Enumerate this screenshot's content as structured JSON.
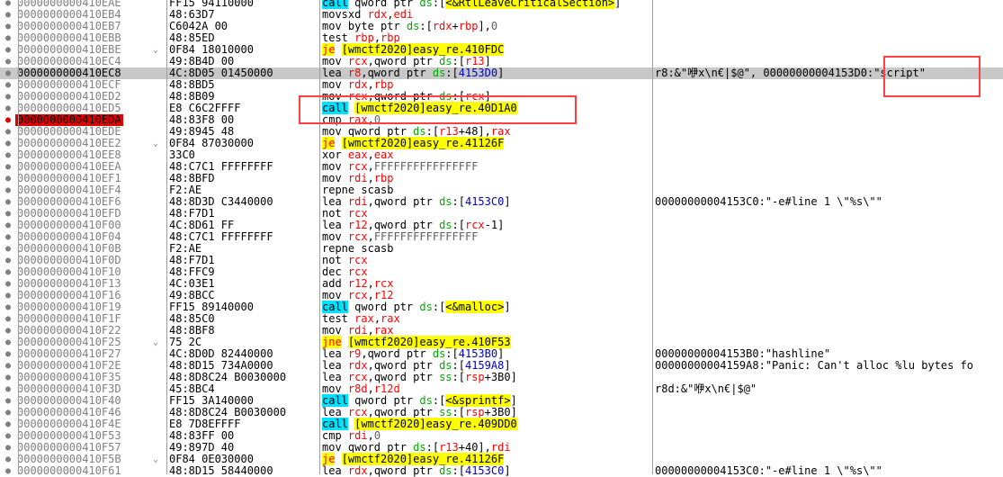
{
  "colors": {
    "call_bg": "#00e0ff",
    "jump_bg": "#ffff00",
    "jump_text": "#ff0000",
    "register": "#ff0000",
    "breakpoint": "#e00000",
    "selected_row": "#c8c8c8",
    "highlight_box": "#ff4040"
  },
  "icons": {
    "breakpoint_dot": "dot-icon",
    "jump_arrow": "chevron-down-icon"
  },
  "rows": [
    {
      "addr": "0000000000410EAE",
      "bytes": "FF15 94110000",
      "dis": [
        {
          "t": "call",
          "c": "mn-call"
        },
        {
          "t": " qword ptr "
        },
        {
          "t": "ds",
          "c": "seg"
        },
        {
          "t": ":["
        },
        {
          "t": "<&RtlLeaveCriticalSection>",
          "c": "tgt"
        },
        {
          "t": "]"
        }
      ],
      "cmt": ""
    },
    {
      "addr": "0000000000410EB4",
      "bytes": "48:63D7",
      "dis": [
        {
          "t": "movsxd "
        },
        {
          "t": "rdx",
          "c": "reg"
        },
        {
          "t": ","
        },
        {
          "t": "edi",
          "c": "reg"
        }
      ],
      "cmt": ""
    },
    {
      "addr": "0000000000410EB7",
      "bytes": "C6042A 00",
      "dis": [
        {
          "t": "mov byte ptr "
        },
        {
          "t": "ds",
          "c": "seg"
        },
        {
          "t": ":["
        },
        {
          "t": "rdx",
          "c": "reg"
        },
        {
          "t": "+"
        },
        {
          "t": "rbp",
          "c": "reg"
        },
        {
          "t": "],"
        },
        {
          "t": "0",
          "c": "imm"
        }
      ],
      "cmt": ""
    },
    {
      "addr": "0000000000410EBB",
      "bytes": "48:85ED",
      "dis": [
        {
          "t": "test "
        },
        {
          "t": "rbp",
          "c": "reg"
        },
        {
          "t": ","
        },
        {
          "t": "rbp",
          "c": "reg"
        }
      ],
      "cmt": ""
    },
    {
      "addr": "0000000000410EBE",
      "bytes": "0F84 18010000",
      "jmp": true,
      "dis": [
        {
          "t": "je",
          "c": "mn-jcc"
        },
        {
          "t": " "
        },
        {
          "t": "[wmctf2020]easy_re.410FDC",
          "c": "tgt"
        }
      ],
      "cmt": ""
    },
    {
      "addr": "0000000000410EC4",
      "bytes": "49:8B4D 00",
      "dis": [
        {
          "t": "mov "
        },
        {
          "t": "rcx",
          "c": "reg"
        },
        {
          "t": ",qword ptr "
        },
        {
          "t": "ds",
          "c": "seg"
        },
        {
          "t": ":["
        },
        {
          "t": "r13",
          "c": "reg"
        },
        {
          "t": "]"
        }
      ],
      "cmt": ""
    },
    {
      "addr": "0000000000410EC8",
      "bytes": "4C:8D05 01450000",
      "sel": true,
      "dis": [
        {
          "t": "lea "
        },
        {
          "t": "r8",
          "c": "reg"
        },
        {
          "t": ",qword ptr "
        },
        {
          "t": "ds",
          "c": "seg"
        },
        {
          "t": ":["
        },
        {
          "t": "4153D0",
          "c": "num"
        },
        {
          "t": "]"
        }
      ],
      "cmt": "r8:&\"咿x\\n€|$@\", 00000000004153D0:\"script\""
    },
    {
      "addr": "0000000000410ECF",
      "bytes": "48:8BD5",
      "dis": [
        {
          "t": "mov "
        },
        {
          "t": "rdx",
          "c": "reg"
        },
        {
          "t": ","
        },
        {
          "t": "rbp",
          "c": "reg"
        }
      ],
      "cmt": ""
    },
    {
      "addr": "0000000000410ED2",
      "bytes": "48:8B09",
      "dis": [
        {
          "t": "mov "
        },
        {
          "t": "rcx",
          "c": "reg"
        },
        {
          "t": ",qword ptr "
        },
        {
          "t": "ds",
          "c": "seg"
        },
        {
          "t": ":["
        },
        {
          "t": "rcx",
          "c": "reg"
        },
        {
          "t": "]"
        }
      ],
      "cmt": ""
    },
    {
      "addr": "0000000000410ED5",
      "bytes": "E8 C6C2FFFF",
      "dis": [
        {
          "t": "call",
          "c": "mn-call"
        },
        {
          "t": " "
        },
        {
          "t": "[wmctf2020]easy_re.40D1A0",
          "c": "tgt"
        }
      ],
      "cmt": ""
    },
    {
      "addr": "0000000000410EDA",
      "bytes": "48:83F8 00",
      "bp": true,
      "dis": [
        {
          "t": "cmp "
        },
        {
          "t": "rax",
          "c": "reg"
        },
        {
          "t": ","
        },
        {
          "t": "0",
          "c": "imm"
        }
      ],
      "cmt": ""
    },
    {
      "addr": "0000000000410EDE",
      "bytes": "49:8945 48",
      "dis": [
        {
          "t": "mov qword ptr "
        },
        {
          "t": "ds",
          "c": "seg"
        },
        {
          "t": ":["
        },
        {
          "t": "r13",
          "c": "reg"
        },
        {
          "t": "+48],"
        },
        {
          "t": "rax",
          "c": "reg"
        }
      ],
      "cmt": ""
    },
    {
      "addr": "0000000000410EE2",
      "bytes": "0F84 87030000",
      "jmp": true,
      "dis": [
        {
          "t": "je",
          "c": "mn-jcc"
        },
        {
          "t": " "
        },
        {
          "t": "[wmctf2020]easy_re.41126F",
          "c": "tgt"
        }
      ],
      "cmt": ""
    },
    {
      "addr": "0000000000410EE8",
      "bytes": "33C0",
      "dis": [
        {
          "t": "xor "
        },
        {
          "t": "eax",
          "c": "reg"
        },
        {
          "t": ","
        },
        {
          "t": "eax",
          "c": "reg"
        }
      ],
      "cmt": ""
    },
    {
      "addr": "0000000000410EEA",
      "bytes": "48:C7C1 FFFFFFFF",
      "dis": [
        {
          "t": "mov "
        },
        {
          "t": "rcx",
          "c": "reg"
        },
        {
          "t": ","
        },
        {
          "t": "FFFFFFFFFFFFFFFF",
          "c": "imm"
        }
      ],
      "cmt": ""
    },
    {
      "addr": "0000000000410EF1",
      "bytes": "48:8BFD",
      "dis": [
        {
          "t": "mov "
        },
        {
          "t": "rdi",
          "c": "reg"
        },
        {
          "t": ","
        },
        {
          "t": "rbp",
          "c": "reg"
        }
      ],
      "cmt": ""
    },
    {
      "addr": "0000000000410EF4",
      "bytes": "F2:AE",
      "dis": [
        {
          "t": "repne scasb"
        }
      ],
      "cmt": ""
    },
    {
      "addr": "0000000000410EF6",
      "bytes": "48:8D3D C3440000",
      "dis": [
        {
          "t": "lea "
        },
        {
          "t": "rdi",
          "c": "reg"
        },
        {
          "t": ",qword ptr "
        },
        {
          "t": "ds",
          "c": "seg"
        },
        {
          "t": ":["
        },
        {
          "t": "4153C0",
          "c": "num"
        },
        {
          "t": "]"
        }
      ],
      "cmt": "00000000004153C0:\"-e#line 1 \\\"%s\\\"\""
    },
    {
      "addr": "0000000000410EFD",
      "bytes": "48:F7D1",
      "dis": [
        {
          "t": "not "
        },
        {
          "t": "rcx",
          "c": "reg"
        }
      ],
      "cmt": ""
    },
    {
      "addr": "0000000000410F00",
      "bytes": "4C:8D61 FF",
      "dis": [
        {
          "t": "lea "
        },
        {
          "t": "r12",
          "c": "reg"
        },
        {
          "t": ",qword ptr "
        },
        {
          "t": "ds",
          "c": "seg"
        },
        {
          "t": ":["
        },
        {
          "t": "rcx",
          "c": "reg"
        },
        {
          "t": "-1]"
        }
      ],
      "cmt": ""
    },
    {
      "addr": "0000000000410F04",
      "bytes": "48:C7C1 FFFFFFFF",
      "dis": [
        {
          "t": "mov "
        },
        {
          "t": "rcx",
          "c": "reg"
        },
        {
          "t": ","
        },
        {
          "t": "FFFFFFFFFFFFFFFF",
          "c": "imm"
        }
      ],
      "cmt": ""
    },
    {
      "addr": "0000000000410F0B",
      "bytes": "F2:AE",
      "dis": [
        {
          "t": "repne scasb"
        }
      ],
      "cmt": ""
    },
    {
      "addr": "0000000000410F0D",
      "bytes": "48:F7D1",
      "dis": [
        {
          "t": "not "
        },
        {
          "t": "rcx",
          "c": "reg"
        }
      ],
      "cmt": ""
    },
    {
      "addr": "0000000000410F10",
      "bytes": "48:FFC9",
      "dis": [
        {
          "t": "dec "
        },
        {
          "t": "rcx",
          "c": "reg"
        }
      ],
      "cmt": ""
    },
    {
      "addr": "0000000000410F13",
      "bytes": "4C:03E1",
      "dis": [
        {
          "t": "add "
        },
        {
          "t": "r12",
          "c": "reg"
        },
        {
          "t": ","
        },
        {
          "t": "rcx",
          "c": "reg"
        }
      ],
      "cmt": ""
    },
    {
      "addr": "0000000000410F16",
      "bytes": "49:8BCC",
      "dis": [
        {
          "t": "mov "
        },
        {
          "t": "rcx",
          "c": "reg"
        },
        {
          "t": ","
        },
        {
          "t": "r12",
          "c": "reg"
        }
      ],
      "cmt": ""
    },
    {
      "addr": "0000000000410F19",
      "bytes": "FF15 89140000",
      "dis": [
        {
          "t": "call",
          "c": "mn-call"
        },
        {
          "t": " qword ptr "
        },
        {
          "t": "ds",
          "c": "seg"
        },
        {
          "t": ":["
        },
        {
          "t": "<&malloc>",
          "c": "tgt"
        },
        {
          "t": "]"
        }
      ],
      "cmt": ""
    },
    {
      "addr": "0000000000410F1F",
      "bytes": "48:85C0",
      "dis": [
        {
          "t": "test "
        },
        {
          "t": "rax",
          "c": "reg"
        },
        {
          "t": ","
        },
        {
          "t": "rax",
          "c": "reg"
        }
      ],
      "cmt": ""
    },
    {
      "addr": "0000000000410F22",
      "bytes": "48:8BF8",
      "dis": [
        {
          "t": "mov "
        },
        {
          "t": "rdi",
          "c": "reg"
        },
        {
          "t": ","
        },
        {
          "t": "rax",
          "c": "reg"
        }
      ],
      "cmt": ""
    },
    {
      "addr": "0000000000410F25",
      "bytes": "75 2C",
      "jmp": true,
      "dis": [
        {
          "t": "jne",
          "c": "mn-jcc"
        },
        {
          "t": " "
        },
        {
          "t": "[wmctf2020]easy_re.410F53",
          "c": "tgt"
        }
      ],
      "cmt": ""
    },
    {
      "addr": "0000000000410F27",
      "bytes": "4C:8D0D 82440000",
      "dis": [
        {
          "t": "lea "
        },
        {
          "t": "r9",
          "c": "reg"
        },
        {
          "t": ",qword ptr "
        },
        {
          "t": "ds",
          "c": "seg"
        },
        {
          "t": ":["
        },
        {
          "t": "4153B0",
          "c": "num"
        },
        {
          "t": "]"
        }
      ],
      "cmt": "00000000004153B0:\"hashline\""
    },
    {
      "addr": "0000000000410F2E",
      "bytes": "48:8D15 734A0000",
      "dis": [
        {
          "t": "lea "
        },
        {
          "t": "rdx",
          "c": "reg"
        },
        {
          "t": ",qword ptr "
        },
        {
          "t": "ds",
          "c": "seg"
        },
        {
          "t": ":["
        },
        {
          "t": "4159A8",
          "c": "num"
        },
        {
          "t": "]"
        }
      ],
      "cmt": "00000000004159A8:\"Panic: Can't alloc %lu bytes fo"
    },
    {
      "addr": "0000000000410F35",
      "bytes": "48:8D8C24 B0030000",
      "dis": [
        {
          "t": "lea "
        },
        {
          "t": "rcx",
          "c": "reg"
        },
        {
          "t": ",qword ptr "
        },
        {
          "t": "ss",
          "c": "seg"
        },
        {
          "t": ":["
        },
        {
          "t": "rsp",
          "c": "reg"
        },
        {
          "t": "+3B0]"
        }
      ],
      "cmt": ""
    },
    {
      "addr": "0000000000410F3D",
      "bytes": "45:8BC4",
      "dis": [
        {
          "t": "mov "
        },
        {
          "t": "r8d",
          "c": "reg"
        },
        {
          "t": ","
        },
        {
          "t": "r12d",
          "c": "reg"
        }
      ],
      "cmt": "r8d:&\"咿x\\n€|$@\""
    },
    {
      "addr": "0000000000410F40",
      "bytes": "FF15 3A140000",
      "dis": [
        {
          "t": "call",
          "c": "mn-call"
        },
        {
          "t": " qword ptr "
        },
        {
          "t": "ds",
          "c": "seg"
        },
        {
          "t": ":["
        },
        {
          "t": "<&sprintf>",
          "c": "tgt"
        },
        {
          "t": "]"
        }
      ],
      "cmt": ""
    },
    {
      "addr": "0000000000410F46",
      "bytes": "48:8D8C24 B0030000",
      "dis": [
        {
          "t": "lea "
        },
        {
          "t": "rcx",
          "c": "reg"
        },
        {
          "t": ",qword ptr "
        },
        {
          "t": "ss",
          "c": "seg"
        },
        {
          "t": ":["
        },
        {
          "t": "rsp",
          "c": "reg"
        },
        {
          "t": "+3B0]"
        }
      ],
      "cmt": ""
    },
    {
      "addr": "0000000000410F4E",
      "bytes": "E8 7D8EFFFF",
      "dis": [
        {
          "t": "call",
          "c": "mn-call"
        },
        {
          "t": " "
        },
        {
          "t": "[wmctf2020]easy_re.409DD0",
          "c": "tgt"
        }
      ],
      "cmt": ""
    },
    {
      "addr": "0000000000410F53",
      "bytes": "48:83FF 00",
      "dis": [
        {
          "t": "cmp "
        },
        {
          "t": "rdi",
          "c": "reg"
        },
        {
          "t": ","
        },
        {
          "t": "0",
          "c": "imm"
        }
      ],
      "cmt": ""
    },
    {
      "addr": "0000000000410F57",
      "bytes": "49:897D 40",
      "dis": [
        {
          "t": "mov qword ptr "
        },
        {
          "t": "ds",
          "c": "seg"
        },
        {
          "t": ":["
        },
        {
          "t": "r13",
          "c": "reg"
        },
        {
          "t": "+40],"
        },
        {
          "t": "rdi",
          "c": "reg"
        }
      ],
      "cmt": ""
    },
    {
      "addr": "0000000000410F5B",
      "bytes": "0F84 0E030000",
      "jmp": true,
      "dis": [
        {
          "t": "je",
          "c": "mn-jcc"
        },
        {
          "t": " "
        },
        {
          "t": "[wmctf2020]easy_re.41126F",
          "c": "tgt"
        }
      ],
      "cmt": ""
    },
    {
      "addr": "0000000000410F61",
      "bytes": "48:8D15 58440000",
      "dis": [
        {
          "t": "lea "
        },
        {
          "t": "rdx",
          "c": "reg"
        },
        {
          "t": ",qword ptr "
        },
        {
          "t": "ds",
          "c": "seg"
        },
        {
          "t": ":["
        },
        {
          "t": "4153C0",
          "c": "num"
        },
        {
          "t": "]"
        }
      ],
      "cmt": "00000000004153C0:\"-e#line 1 \\\"%s\\\"\""
    }
  ]
}
